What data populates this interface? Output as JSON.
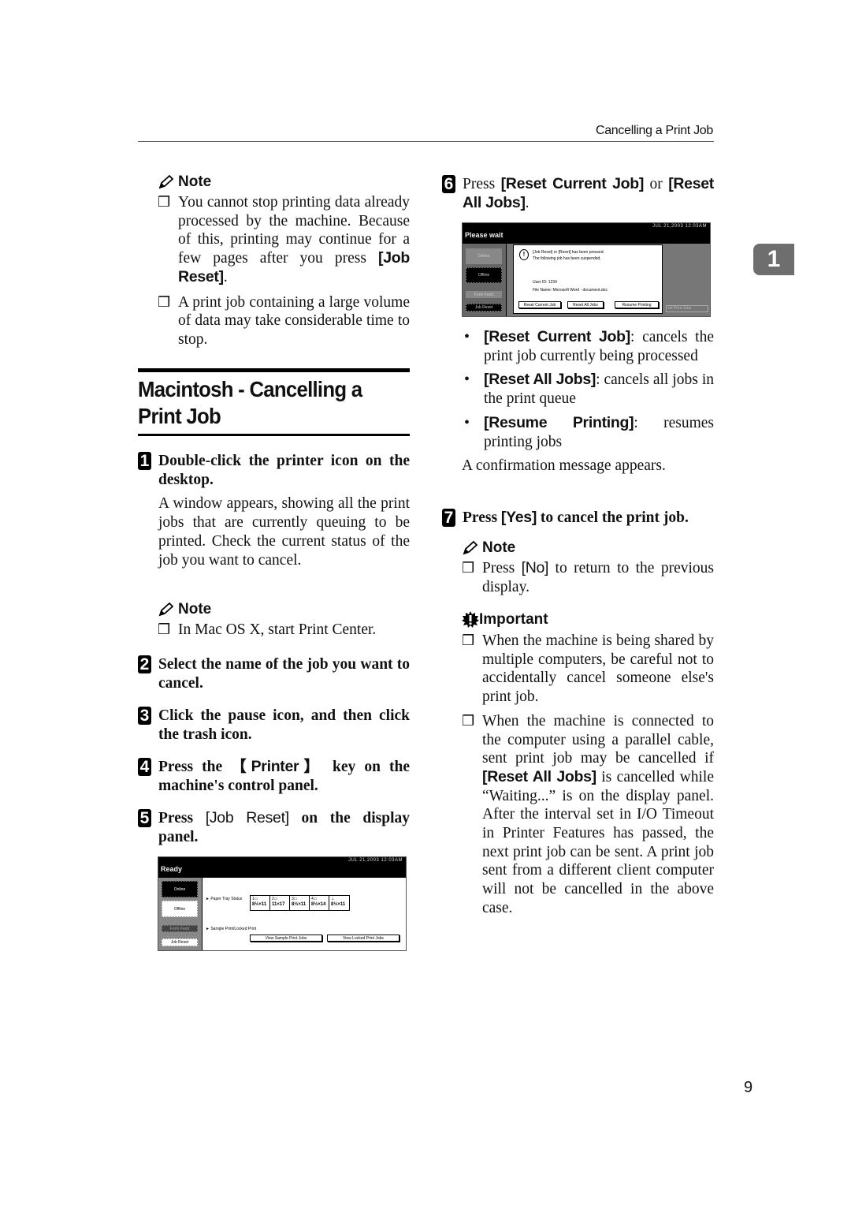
{
  "header": {
    "running_head": "Cancelling a Print Job"
  },
  "chapter_tab": {
    "label": "1"
  },
  "page_number": "9",
  "left_column": {
    "note1": {
      "heading": "Note",
      "items": [
        {
          "text_before": "You cannot stop printing data already processed by the machine. Because of this, printing may continue for a few pages after you press ",
          "key": "[Job Reset]",
          "text_after": "."
        },
        {
          "text": "A print job containing a large volume of data may take considerable time to stop."
        }
      ]
    },
    "section_title": "Macintosh - Cancelling a Print Job",
    "steps": [
      {
        "num": "1",
        "text": "Double-click the printer icon on the desktop.",
        "body": "A window appears, showing all the print jobs that are currently queuing to be printed. Check the current status of the job you want to cancel."
      },
      {
        "num": "2",
        "text": "Select the name of the job you want to cancel."
      },
      {
        "num": "3",
        "text": "Click the pause icon, and then click the trash icon."
      },
      {
        "num": "4",
        "text_before": "Press the ",
        "key": "【Printer】",
        "text_after": " key on the machine's control panel."
      },
      {
        "num": "5",
        "text_before": "Press ",
        "key": "[Job Reset]",
        "text_after": " on the display panel."
      }
    ],
    "note2": {
      "heading": "Note",
      "items": [
        {
          "text": "In Mac OS X, start Print Center."
        }
      ]
    },
    "ready_panel": {
      "clock": "JUL  21,2003 12:03AM",
      "title": "Ready",
      "buttons": [
        "Online",
        "Offline",
        "Form Feed",
        "Job Reset"
      ],
      "paper_tray_label": "Paper Tray Status",
      "trays": [
        {
          "id": "1",
          "size": "8½×11"
        },
        {
          "id": "2",
          "size": "11×17"
        },
        {
          "id": "3",
          "size": "8½×11"
        },
        {
          "id": "4",
          "size": "8½×14"
        },
        {
          "id": "bypass",
          "size": "8½×11"
        }
      ],
      "sample_print_label": "Sample Print/Locked Print",
      "view_sample": "View Sample Print Jobs",
      "view_locked": "View Locked Print Jobs"
    }
  },
  "right_column": {
    "step6": {
      "num": "6",
      "text_before": "Press ",
      "key1": "[Reset Current Job]",
      "mid": " or ",
      "key2": "[Reset All Jobs]",
      "text_after": "."
    },
    "wait_panel": {
      "clock": "JUL  21,2003 12:03AM",
      "title": "Please wait",
      "buttons": [
        "Online",
        "Offline",
        "Form Feed",
        "Job Reset"
      ],
      "dialog_line1": "[Job Reset] or [Reset] has been pressed.",
      "dialog_line2": "The following job has been suspended.",
      "user_id": "User ID: 1234",
      "file_name": "File Name: Microsoft Word - document.doc",
      "dialog_buttons": [
        "Reset Current Job",
        "Reset All Jobs",
        "Resume Printing"
      ],
      "behind_button": "ed Print Jobs"
    },
    "bullets": [
      {
        "key": "[Reset Current Job]",
        "text": ": cancels the print job currently being processed"
      },
      {
        "key": "[Reset All Jobs]",
        "text": ": cancels all jobs in the print queue"
      },
      {
        "key": "[Resume Printing]",
        "text": ": resumes printing jobs"
      }
    ],
    "confirmation": "A confirmation message appears.",
    "step7": {
      "num": "7",
      "text_before": "Press ",
      "key": "[Yes]",
      "text_after": " to cancel the print job."
    },
    "note3": {
      "heading": "Note",
      "item_before": "Press ",
      "item_key": "[No]",
      "item_after": " to return to the previous display."
    },
    "important": {
      "heading": "Important",
      "items": [
        {
          "text": "When the machine is being shared by multiple computers, be careful not to accidentally cancel someone else's print job."
        },
        {
          "text_before": "When the machine is connected to the computer using a parallel cable, sent print job may be cancelled if ",
          "key": "[Reset All Jobs]",
          "text_after": " is cancelled while “Waiting...” is on the display panel. After the interval set in I/O Timeout in Printer Features has passed, the next print job can be sent. A print job sent from a different client computer will not be cancelled in the above case."
        }
      ]
    }
  }
}
